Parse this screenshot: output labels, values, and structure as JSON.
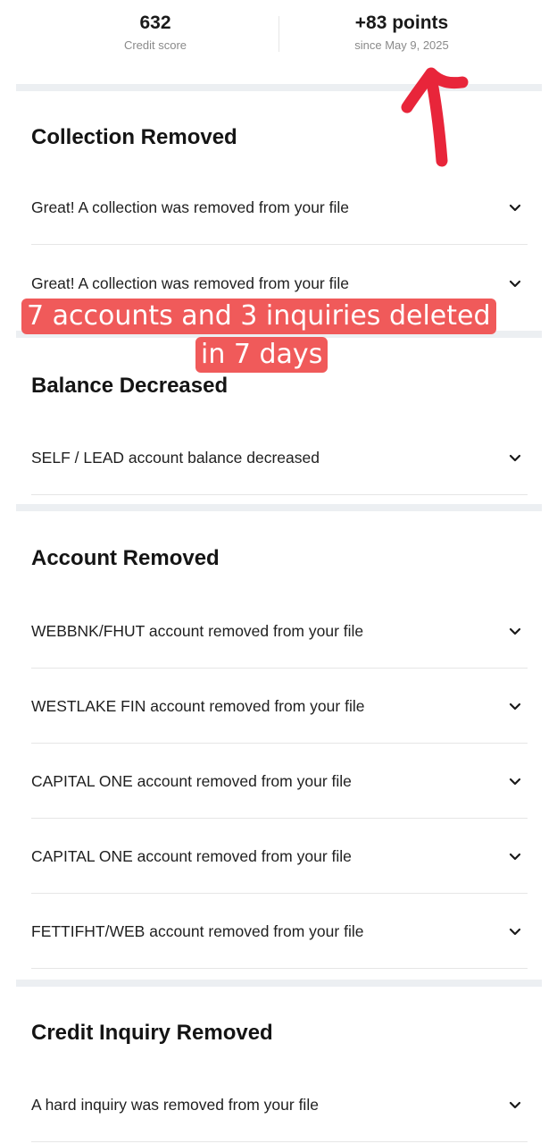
{
  "stats": {
    "score_value": "632",
    "score_label": "Credit score",
    "change_value": "+83 points",
    "change_label": "since May 9, 2025"
  },
  "sections": {
    "collection": {
      "title": "Collection Removed",
      "items": [
        "Great! A collection was removed from your file",
        "Great! A collection was removed from your file"
      ]
    },
    "balance": {
      "title": "Balance Decreased",
      "items": [
        "SELF / LEAD account balance decreased"
      ]
    },
    "account": {
      "title": "Account Removed",
      "items": [
        "WEBBNK/FHUT account removed from your file",
        "WESTLAKE FIN account removed from your file",
        "CAPITAL ONE account removed from your file",
        "CAPITAL ONE account removed from your file",
        "FETTIFHT/WEB account removed from your file"
      ]
    },
    "inquiry": {
      "title": "Credit Inquiry Removed",
      "items": [
        "A hard inquiry was removed from your file"
      ]
    }
  },
  "overlay": {
    "line1": "7 accounts and 3 inquiries deleted",
    "line2": "in 7 days"
  },
  "colors": {
    "caption_bg": "#f05a5a",
    "arrow": "#e8253a",
    "divider_bar": "#eceff2"
  },
  "icons": {
    "expand": "chevron-down-icon",
    "annotation": "hand-drawn-arrow"
  }
}
